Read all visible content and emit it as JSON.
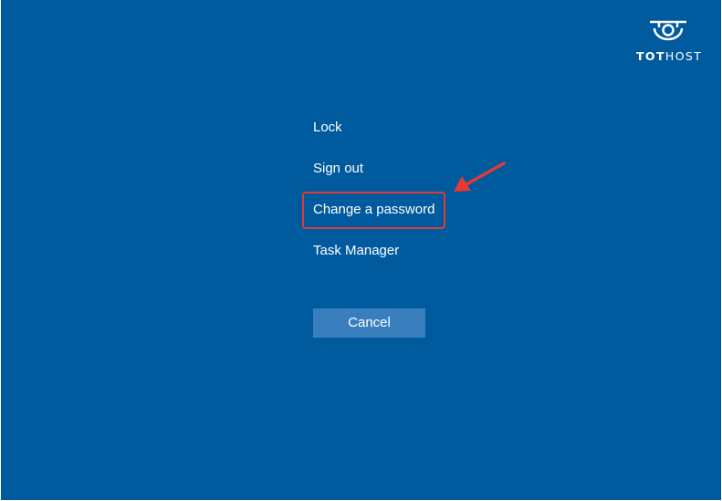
{
  "logo": {
    "icon": "tothost-logo-icon",
    "text_bold": "TOT",
    "text_regular": "HOST"
  },
  "menu": {
    "items": [
      {
        "label": "Lock"
      },
      {
        "label": "Sign out"
      },
      {
        "label": "Change a password"
      },
      {
        "label": "Task Manager"
      }
    ]
  },
  "cancel_label": "Cancel",
  "annotation": {
    "highlight_color": "#e53935",
    "arrow_icon": "red-arrow-icon"
  },
  "colors": {
    "background": "#005a9e",
    "button": "#3a7fbd",
    "text": "#ffffff"
  }
}
